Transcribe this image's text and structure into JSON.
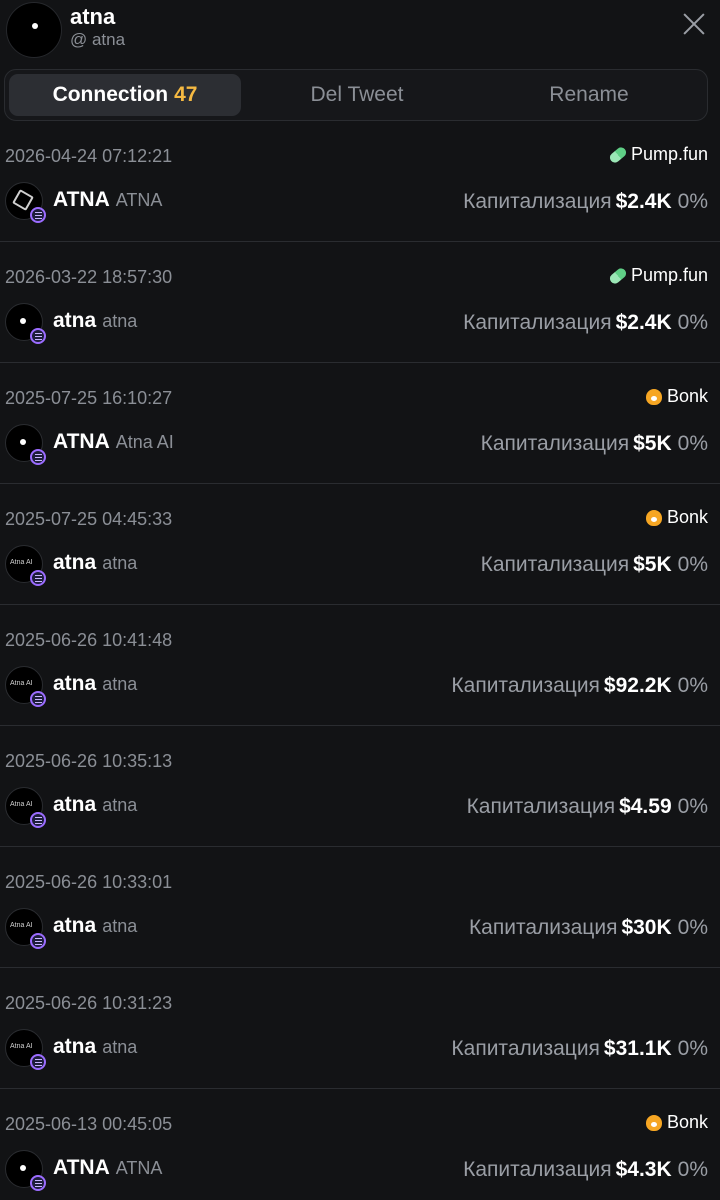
{
  "header": {
    "name": "atna",
    "handle": "@ atna"
  },
  "tabs": [
    {
      "label": "Connection",
      "count": "47",
      "active": true
    },
    {
      "label": "Del Tweet"
    },
    {
      "label": "Rename"
    }
  ],
  "mcap_label": "Капитализация",
  "rows": [
    {
      "date": "2026-04-24 07:12:21",
      "launchpad": "Pump.fun",
      "launchpad_icon": "pill-icon",
      "ticker": "ATNA",
      "name": "ATNA",
      "avatar": "cube",
      "mcap": "$2.4K",
      "change": "0%"
    },
    {
      "date": "2026-03-22 18:57:30",
      "launchpad": "Pump.fun",
      "launchpad_icon": "pill-icon",
      "ticker": "atna",
      "name": "atna",
      "avatar": "dot",
      "mcap": "$2.4K",
      "change": "0%"
    },
    {
      "date": "2025-07-25 16:10:27",
      "launchpad": "Bonk",
      "launchpad_icon": "bonk-icon",
      "ticker": "ATNA",
      "name": "Atna AI",
      "avatar": "dot",
      "mcap": "$5K",
      "change": "0%"
    },
    {
      "date": "2025-07-25 04:45:33",
      "launchpad": "Bonk",
      "launchpad_icon": "bonk-icon",
      "ticker": "atna",
      "name": "atna",
      "avatar": "text",
      "avatar_text": "Atna AI",
      "mcap": "$5K",
      "change": "0%"
    },
    {
      "date": "2025-06-26 10:41:48",
      "launchpad": "",
      "ticker": "atna",
      "name": "atna",
      "avatar": "text",
      "avatar_text": "Atna AI",
      "mcap": "$92.2K",
      "change": "0%"
    },
    {
      "date": "2025-06-26 10:35:13",
      "launchpad": "",
      "ticker": "atna",
      "name": "atna",
      "avatar": "text",
      "avatar_text": "Atna AI",
      "mcap": "$4.59",
      "change": "0%"
    },
    {
      "date": "2025-06-26 10:33:01",
      "launchpad": "",
      "ticker": "atna",
      "name": "atna",
      "avatar": "text",
      "avatar_text": "Atna AI",
      "mcap": "$30K",
      "change": "0%"
    },
    {
      "date": "2025-06-26 10:31:23",
      "launchpad": "",
      "ticker": "atna",
      "name": "atna",
      "avatar": "text",
      "avatar_text": "Atna AI",
      "mcap": "$31.1K",
      "change": "0%"
    },
    {
      "date": "2025-06-13 00:45:05",
      "launchpad": "Bonk",
      "launchpad_icon": "bonk-icon",
      "ticker": "ATNA",
      "name": "ATNA",
      "avatar": "dot",
      "mcap": "$4.3K",
      "change": "0%"
    }
  ]
}
